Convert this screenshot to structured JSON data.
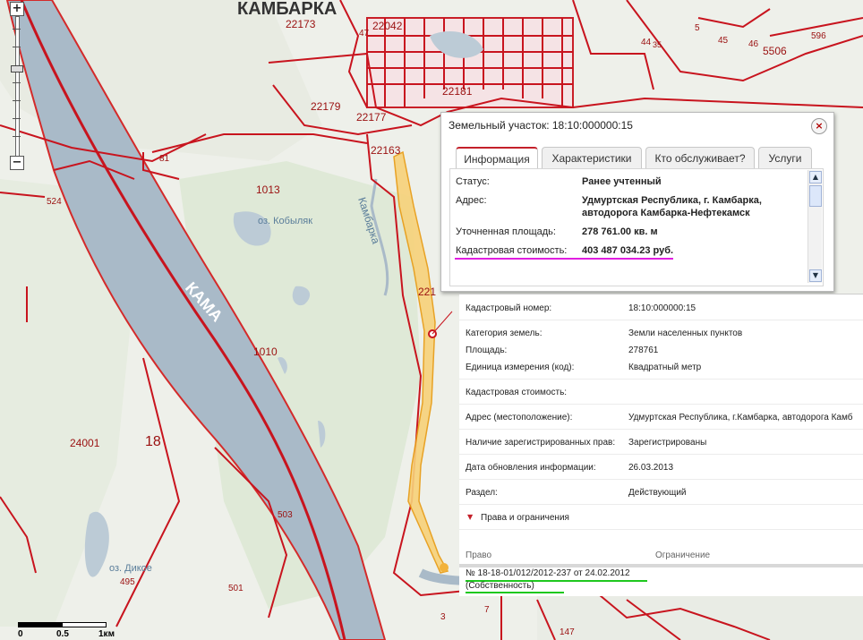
{
  "map": {
    "town_label": "КАМБАРКА",
    "river_kama": "КАМА",
    "river_kambarka": "Камбарка",
    "lake_kobylyak": "оз. Кобыляк",
    "lake_dikoe": "оз. Дикое",
    "parcel_labels": [
      "22173",
      "22042",
      "47",
      "22181",
      "22179",
      "22177",
      "22163",
      "221",
      "81",
      "524",
      "1013",
      "1010",
      "24001",
      "18",
      "503",
      "495",
      "501",
      "5506",
      "596",
      "46",
      "45",
      "44",
      "35",
      "5",
      "3",
      "7",
      "147"
    ]
  },
  "zoom": {
    "plus": "+",
    "minus": "−"
  },
  "scale": {
    "labels": [
      "0",
      "0.5",
      "1км"
    ]
  },
  "popup": {
    "title": "Земельный участок: 18:10:000000:15",
    "close_label": "×",
    "tabs": [
      "Информация",
      "Характеристики",
      "Кто обслуживает?",
      "Услуги"
    ],
    "info": [
      {
        "label": "Статус:",
        "value": "Ранее учтенный"
      },
      {
        "label": "Адрес:",
        "value": "Удмуртская Республика, г. Камбарка, автодорога Камбарка-Нефтекамск"
      },
      {
        "label": "Уточненная площадь:",
        "value": "278 761.00 кв. м"
      },
      {
        "label": "Кадастровая стоимость:",
        "value": "403 487 034.23 руб."
      }
    ]
  },
  "details": {
    "rows": [
      {
        "key": "Кадастровый номер:",
        "value": "18:10:000000:15"
      },
      {
        "key": "Категория земель:",
        "value": "Земли населенных пунктов"
      },
      {
        "key": "Площадь:",
        "value": "278761"
      },
      {
        "key": "Единица измерения (код):",
        "value": "Квадратный метр"
      },
      {
        "key": "Кадастровая стоимость:",
        "value": ""
      },
      {
        "key": "Адрес (местоположение):",
        "value": "Удмуртская Республика, г.Камбарка, автодорога Камб"
      },
      {
        "key": "Наличие зарегистрированных прав:",
        "value": "Зарегистрированы"
      },
      {
        "key": "Дата обновления информации:",
        "value": "26.03.2013"
      },
      {
        "key": "Раздел:",
        "value": "Действующий"
      }
    ],
    "section_title": "Права и ограничения",
    "col_right": "Право",
    "col_limit": "Ограничение",
    "right_number": "№ 18-18-01/012/2012-237   от 24.02.2012",
    "right_type": "(Собственность)"
  },
  "colors": {
    "parcel": "#c8141e",
    "river": "#a9bac8",
    "road": "#f4b942",
    "highlight_magenta": "#e01ee0",
    "highlight_green": "#1ec81e"
  }
}
